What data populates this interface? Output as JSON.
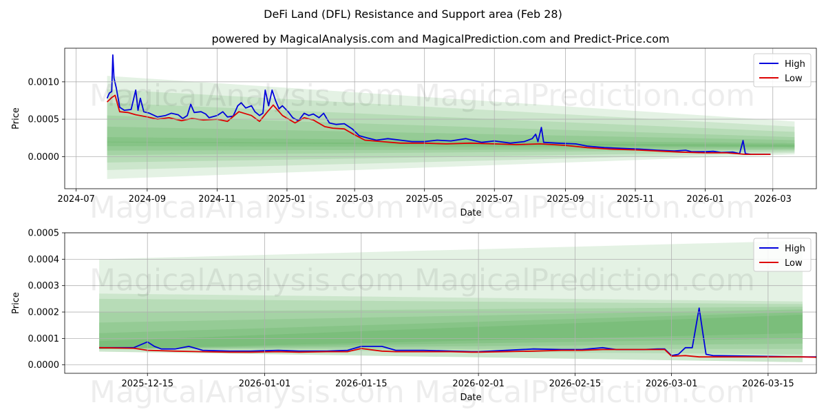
{
  "suptitle": "DeFi Land (DFL) Resistance and Support area (Feb 28)",
  "subtitle": "powered by MagicalAnalysis.com and MagicalPrediction.com and Predict-Price.com",
  "watermarks": [
    "MagicalAnalysis.com",
    "MagicalPrediction.com"
  ],
  "colors": {
    "high": "#0000dd",
    "low": "#dd0000",
    "band": "#2e9a2e",
    "grid": "#b0b0b0"
  },
  "chart_data": [
    {
      "type": "line",
      "xlabel": "Date",
      "ylabel": "Price",
      "x_ticks": [
        "2024-07",
        "2024-09",
        "2024-11",
        "2025-01",
        "2025-03",
        "2025-05",
        "2025-07",
        "2025-09",
        "2025-11",
        "2026-01",
        "2026-03"
      ],
      "y_ticks": [
        "0.0000",
        "0.0005",
        "0.0010"
      ],
      "xlim": [
        "2024-06-21",
        "2026-04-08"
      ],
      "ylim": [
        -0.00043,
        0.00145
      ],
      "grid": true,
      "legend": "top-right",
      "series": [
        {
          "name": "High",
          "color": "#0000dd",
          "points": [
            [
              "2024-07-28",
              0.00078
            ],
            [
              "2024-07-30",
              0.00085
            ],
            [
              "2024-08-01",
              0.00087
            ],
            [
              "2024-08-02",
              0.00136
            ],
            [
              "2024-08-03",
              0.00105
            ],
            [
              "2024-08-05",
              0.00092
            ],
            [
              "2024-08-08",
              0.00066
            ],
            [
              "2024-08-12",
              0.00062
            ],
            [
              "2024-08-18",
              0.00063
            ],
            [
              "2024-08-22",
              0.00089
            ],
            [
              "2024-08-24",
              0.00062
            ],
            [
              "2024-08-26",
              0.00078
            ],
            [
              "2024-08-29",
              0.0006
            ],
            [
              "2024-09-03",
              0.00058
            ],
            [
              "2024-09-10",
              0.00053
            ],
            [
              "2024-09-17",
              0.00055
            ],
            [
              "2024-09-22",
              0.00058
            ],
            [
              "2024-09-28",
              0.00056
            ],
            [
              "2024-10-02",
              0.00051
            ],
            [
              "2024-10-06",
              0.00055
            ],
            [
              "2024-10-09",
              0.0007
            ],
            [
              "2024-10-12",
              0.00059
            ],
            [
              "2024-10-18",
              0.0006
            ],
            [
              "2024-10-22",
              0.00057
            ],
            [
              "2024-10-25",
              0.00052
            ],
            [
              "2024-11-01",
              0.00055
            ],
            [
              "2024-11-06",
              0.0006
            ],
            [
              "2024-11-10",
              0.00053
            ],
            [
              "2024-11-15",
              0.00054
            ],
            [
              "2024-11-19",
              0.00068
            ],
            [
              "2024-11-22",
              0.00072
            ],
            [
              "2024-11-26",
              0.00065
            ],
            [
              "2024-12-01",
              0.00068
            ],
            [
              "2024-12-04",
              0.0006
            ],
            [
              "2024-12-08",
              0.00055
            ],
            [
              "2024-12-11",
              0.00058
            ],
            [
              "2024-12-13",
              0.00089
            ],
            [
              "2024-12-16",
              0.00068
            ],
            [
              "2024-12-19",
              0.00089
            ],
            [
              "2024-12-22",
              0.00075
            ],
            [
              "2024-12-25",
              0.00064
            ],
            [
              "2024-12-28",
              0.00068
            ],
            [
              "2025-01-02",
              0.0006
            ],
            [
              "2025-01-06",
              0.00052
            ],
            [
              "2025-01-11",
              0.00048
            ],
            [
              "2025-01-16",
              0.00058
            ],
            [
              "2025-01-20",
              0.00055
            ],
            [
              "2025-01-24",
              0.00057
            ],
            [
              "2025-01-29",
              0.00052
            ],
            [
              "2025-02-02",
              0.00058
            ],
            [
              "2025-02-07",
              0.00045
            ],
            [
              "2025-02-13",
              0.00043
            ],
            [
              "2025-02-20",
              0.00044
            ],
            [
              "2025-02-27",
              0.00037
            ],
            [
              "2025-03-05",
              0.00028
            ],
            [
              "2025-03-12",
              0.00025
            ],
            [
              "2025-03-20",
              0.00022
            ],
            [
              "2025-03-30",
              0.00024
            ],
            [
              "2025-04-10",
              0.00022
            ],
            [
              "2025-04-20",
              0.0002
            ],
            [
              "2025-05-01",
              0.0002
            ],
            [
              "2025-05-12",
              0.00022
            ],
            [
              "2025-05-24",
              0.00021
            ],
            [
              "2025-06-06",
              0.00024
            ],
            [
              "2025-06-20",
              0.00019
            ],
            [
              "2025-07-01",
              0.00021
            ],
            [
              "2025-07-15",
              0.00018
            ],
            [
              "2025-07-27",
              0.0002
            ],
            [
              "2025-08-03",
              0.00024
            ],
            [
              "2025-08-06",
              0.0003
            ],
            [
              "2025-08-08",
              0.0002
            ],
            [
              "2025-08-11",
              0.00039
            ],
            [
              "2025-08-13",
              0.00019
            ],
            [
              "2025-08-25",
              0.00018
            ],
            [
              "2025-09-10",
              0.00017
            ],
            [
              "2025-09-20",
              0.00014
            ],
            [
              "2025-10-05",
              0.00012
            ],
            [
              "2025-10-20",
              0.00011
            ],
            [
              "2025-11-05",
              0.0001
            ],
            [
              "2025-11-20",
              8.5e-05
            ],
            [
              "2025-12-05",
              7.5e-05
            ],
            [
              "2025-12-15",
              8.5e-05
            ],
            [
              "2025-12-20",
              6.5e-05
            ],
            [
              "2026-01-01",
              6.5e-05
            ],
            [
              "2026-01-08",
              7e-05
            ],
            [
              "2026-01-15",
              5.5e-05
            ],
            [
              "2026-01-25",
              6e-05
            ],
            [
              "2026-01-31",
              4e-05
            ],
            [
              "2026-02-03",
              0.000215
            ],
            [
              "2026-02-05",
              4e-05
            ],
            [
              "2026-02-10",
              3e-05
            ],
            [
              "2026-02-27",
              3e-05
            ]
          ]
        },
        {
          "name": "Low",
          "color": "#dd0000",
          "points": [
            [
              "2024-07-28",
              0.00073
            ],
            [
              "2024-08-01",
              0.00079
            ],
            [
              "2024-08-04",
              0.00082
            ],
            [
              "2024-08-08",
              0.0006
            ],
            [
              "2024-08-15",
              0.00059
            ],
            [
              "2024-08-22",
              0.00056
            ],
            [
              "2024-09-01",
              0.00053
            ],
            [
              "2024-09-10",
              0.0005
            ],
            [
              "2024-09-20",
              0.00052
            ],
            [
              "2024-10-01",
              0.00048
            ],
            [
              "2024-10-10",
              0.00051
            ],
            [
              "2024-10-20",
              0.00049
            ],
            [
              "2024-11-01",
              0.0005
            ],
            [
              "2024-11-10",
              0.00047
            ],
            [
              "2024-11-20",
              0.0006
            ],
            [
              "2024-12-01",
              0.00055
            ],
            [
              "2024-12-08",
              0.00047
            ],
            [
              "2024-12-15",
              0.0006
            ],
            [
              "2024-12-20",
              0.00069
            ],
            [
              "2024-12-28",
              0.00055
            ],
            [
              "2025-01-08",
              0.00045
            ],
            [
              "2025-01-16",
              0.00052
            ],
            [
              "2025-01-24",
              0.00049
            ],
            [
              "2025-02-03",
              0.0004
            ],
            [
              "2025-02-10",
              0.00038
            ],
            [
              "2025-02-20",
              0.00037
            ],
            [
              "2025-02-28",
              0.0003
            ],
            [
              "2025-03-10",
              0.00022
            ],
            [
              "2025-03-25",
              0.0002
            ],
            [
              "2025-04-10",
              0.00018
            ],
            [
              "2025-05-01",
              0.00018
            ],
            [
              "2025-05-20",
              0.00017
            ],
            [
              "2025-06-10",
              0.00018
            ],
            [
              "2025-07-01",
              0.00017
            ],
            [
              "2025-07-20",
              0.00016
            ],
            [
              "2025-08-10",
              0.00017
            ],
            [
              "2025-09-01",
              0.00015
            ],
            [
              "2025-09-20",
              0.00012
            ],
            [
              "2025-10-10",
              0.0001
            ],
            [
              "2025-11-01",
              9e-05
            ],
            [
              "2025-11-20",
              7.5e-05
            ],
            [
              "2025-12-10",
              6e-05
            ],
            [
              "2026-01-01",
              5e-05
            ],
            [
              "2026-01-20",
              5e-05
            ],
            [
              "2026-02-05",
              3e-05
            ],
            [
              "2026-02-27",
              3e-05
            ]
          ]
        }
      ]
    },
    {
      "type": "line",
      "xlabel": "Date",
      "ylabel": "Price",
      "x_ticks": [
        "2025-12-15",
        "2026-01-01",
        "2026-01-15",
        "2026-02-01",
        "2026-02-15",
        "2026-03-01",
        "2026-03-15"
      ],
      "y_ticks": [
        "0.0000",
        "0.0001",
        "0.0002",
        "0.0003",
        "0.0004",
        "0.0005"
      ],
      "xlim": [
        "2025-12-03",
        "2026-03-22"
      ],
      "ylim": [
        -3.2e-05,
        0.0005
      ],
      "grid": true,
      "legend": "top-right",
      "series": [
        {
          "name": "High",
          "color": "#0000dd",
          "points": [
            [
              "2025-12-08",
              6.5e-05
            ],
            [
              "2025-12-13",
              6.5e-05
            ],
            [
              "2025-12-15",
              8.7e-05
            ],
            [
              "2025-12-16",
              7e-05
            ],
            [
              "2025-12-17",
              6e-05
            ],
            [
              "2025-12-19",
              6e-05
            ],
            [
              "2025-12-21",
              7e-05
            ],
            [
              "2025-12-23",
              5.5e-05
            ],
            [
              "2025-12-27",
              5.2e-05
            ],
            [
              "2025-12-30",
              5.2e-05
            ],
            [
              "2026-01-03",
              5.5e-05
            ],
            [
              "2026-01-06",
              5.2e-05
            ],
            [
              "2026-01-10",
              5.2e-05
            ],
            [
              "2026-01-13",
              5.5e-05
            ],
            [
              "2026-01-15",
              7e-05
            ],
            [
              "2026-01-18",
              7e-05
            ],
            [
              "2026-01-20",
              5.5e-05
            ],
            [
              "2026-01-24",
              5.5e-05
            ],
            [
              "2026-01-28",
              5.2e-05
            ],
            [
              "2026-01-31",
              5e-05
            ],
            [
              "2026-02-01",
              5e-05
            ],
            [
              "2026-02-09",
              6e-05
            ],
            [
              "2026-02-13",
              5.8e-05
            ],
            [
              "2026-02-16",
              5.8e-05
            ],
            [
              "2026-02-19",
              6.5e-05
            ],
            [
              "2026-02-21",
              5.8e-05
            ],
            [
              "2026-02-23",
              5.8e-05
            ],
            [
              "2026-02-25",
              5.8e-05
            ],
            [
              "2026-02-27",
              6e-05
            ],
            [
              "2026-02-28",
              6e-05
            ],
            [
              "2026-03-01",
              3.5e-05
            ],
            [
              "2026-03-02",
              4e-05
            ],
            [
              "2026-03-03",
              6.5e-05
            ],
            [
              "2026-03-04",
              6.5e-05
            ],
            [
              "2026-03-05",
              0.000215
            ],
            [
              "2026-03-06",
              4e-05
            ],
            [
              "2026-03-07",
              3.5e-05
            ],
            [
              "2026-03-20",
              3e-05
            ],
            [
              "2026-03-28",
              3e-05
            ]
          ]
        },
        {
          "name": "Low",
          "color": "#dd0000",
          "points": [
            [
              "2025-12-08",
              6.5e-05
            ],
            [
              "2025-12-13",
              6.3e-05
            ],
            [
              "2025-12-15",
              5.5e-05
            ],
            [
              "2025-12-19",
              5.2e-05
            ],
            [
              "2025-12-23",
              5e-05
            ],
            [
              "2025-12-27",
              4.8e-05
            ],
            [
              "2025-12-30",
              4.8e-05
            ],
            [
              "2026-01-03",
              5e-05
            ],
            [
              "2026-01-06",
              4.8e-05
            ],
            [
              "2026-01-10",
              5e-05
            ],
            [
              "2026-01-13",
              5e-05
            ],
            [
              "2026-01-15",
              6.2e-05
            ],
            [
              "2026-01-18",
              5.2e-05
            ],
            [
              "2026-01-20",
              5e-05
            ],
            [
              "2026-01-24",
              5e-05
            ],
            [
              "2026-01-28",
              5e-05
            ],
            [
              "2026-01-31",
              4.8e-05
            ],
            [
              "2026-02-01",
              4.8e-05
            ],
            [
              "2026-02-09",
              5.2e-05
            ],
            [
              "2026-02-13",
              5.5e-05
            ],
            [
              "2026-02-16",
              5.5e-05
            ],
            [
              "2026-02-19",
              5.8e-05
            ],
            [
              "2026-02-22",
              5.8e-05
            ],
            [
              "2026-02-27",
              5.8e-05
            ],
            [
              "2026-02-28",
              5.8e-05
            ],
            [
              "2026-03-01",
              3.3e-05
            ],
            [
              "2026-03-03",
              3.5e-05
            ],
            [
              "2026-03-05",
              3e-05
            ],
            [
              "2026-03-07",
              3e-05
            ],
            [
              "2026-03-20",
              3e-05
            ],
            [
              "2026-03-27",
              2.5e-05
            ],
            [
              "2026-03-28",
              3e-05
            ]
          ]
        }
      ]
    }
  ]
}
